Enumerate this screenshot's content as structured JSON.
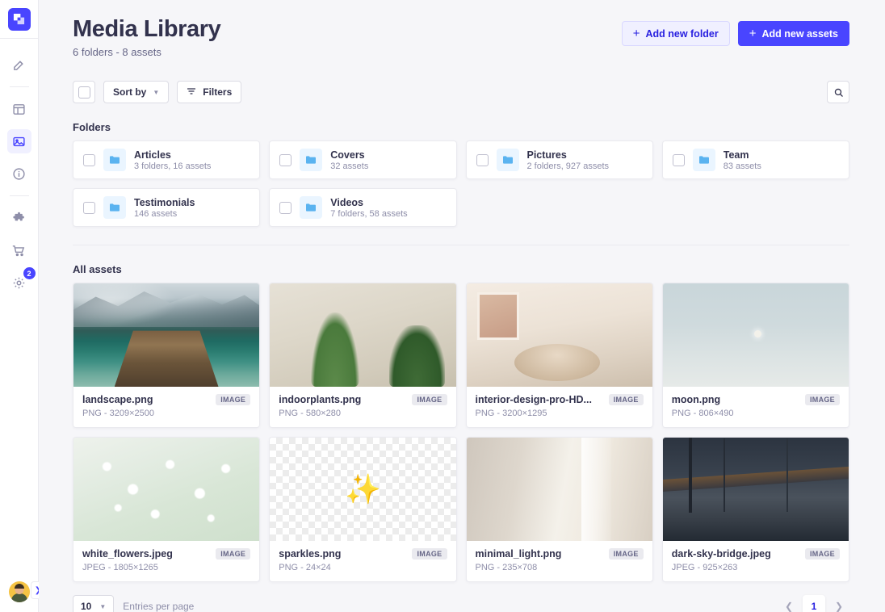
{
  "sidebar": {
    "logo_icon": "strapi-logo-icon",
    "items": [
      {
        "name": "content-manager-edit",
        "icon": "pencil-square-icon",
        "active": false
      },
      {
        "name": "content-type-builder",
        "icon": "layout-icon",
        "active": false
      },
      {
        "name": "media-library",
        "icon": "media-image-icon",
        "active": true
      },
      {
        "name": "documentation",
        "icon": "info-circle-icon",
        "active": false
      },
      {
        "name": "plugins",
        "icon": "puzzle-piece-icon",
        "active": false
      },
      {
        "name": "marketplace",
        "icon": "shopping-cart-icon",
        "active": false
      },
      {
        "name": "settings",
        "icon": "gear-icon",
        "active": false,
        "badge": "2"
      }
    ],
    "avatar_name": "user-avatar",
    "expand_icon": "chevron-right-icon"
  },
  "header": {
    "title": "Media Library",
    "subtitle": "6 folders - 8 assets",
    "add_folder_label": "Add new folder",
    "add_assets_label": "Add new assets",
    "plus_icon": "plus-icon"
  },
  "toolbar": {
    "select_all_name": "select-all-checkbox",
    "sort_label": "Sort by",
    "filters_label": "Filters",
    "filter_icon": "filter-icon",
    "caret_icon": "chevron-down-icon",
    "search_icon": "search-icon"
  },
  "sections": {
    "folders_label": "Folders",
    "assets_label": "All assets"
  },
  "folders": [
    {
      "name": "Articles",
      "meta": "3 folders, 16 assets"
    },
    {
      "name": "Covers",
      "meta": "32 assets"
    },
    {
      "name": "Pictures",
      "meta": "2 folders, 927 assets"
    },
    {
      "name": "Team",
      "meta": "83 assets"
    },
    {
      "name": "Testimonials",
      "meta": "146 assets"
    },
    {
      "name": "Videos",
      "meta": "7 folders, 58 assets"
    }
  ],
  "assets": [
    {
      "name": "landscape.png",
      "meta": "PNG - 3209×2500",
      "tag": "IMAGE",
      "thumb": "th-landscape"
    },
    {
      "name": "indoorplants.png",
      "meta": "PNG - 580×280",
      "tag": "IMAGE",
      "thumb": "th-plants"
    },
    {
      "name": "interior-design-pro-HD...",
      "meta": "PNG - 3200×1295",
      "tag": "IMAGE",
      "thumb": "th-interior"
    },
    {
      "name": "moon.png",
      "meta": "PNG - 806×490",
      "tag": "IMAGE",
      "thumb": "th-moon"
    },
    {
      "name": "white_flowers.jpeg",
      "meta": "JPEG - 1805×1265",
      "tag": "IMAGE",
      "thumb": "th-flowers"
    },
    {
      "name": "sparkles.png",
      "meta": "PNG - 24×24",
      "tag": "IMAGE",
      "thumb": "th-checker",
      "glyph": "✨"
    },
    {
      "name": "minimal_light.png",
      "meta": "PNG - 235×708",
      "tag": "IMAGE",
      "thumb": "th-minimal"
    },
    {
      "name": "dark-sky-bridge.jpeg",
      "meta": "JPEG - 925×263",
      "tag": "IMAGE",
      "thumb": "th-bridge"
    }
  ],
  "footer": {
    "entries_value": "10",
    "entries_label": "Entries per page",
    "prev_icon": "chevron-left-icon",
    "next_icon": "chevron-right-icon",
    "current_page": "1"
  },
  "colors": {
    "brand": "#4945ff",
    "brand_light": "#f0f0ff",
    "text": "#32324d",
    "muted": "#8e8ea9",
    "bg": "#f6f6f9",
    "folder_accent": "#5ab3f0"
  }
}
